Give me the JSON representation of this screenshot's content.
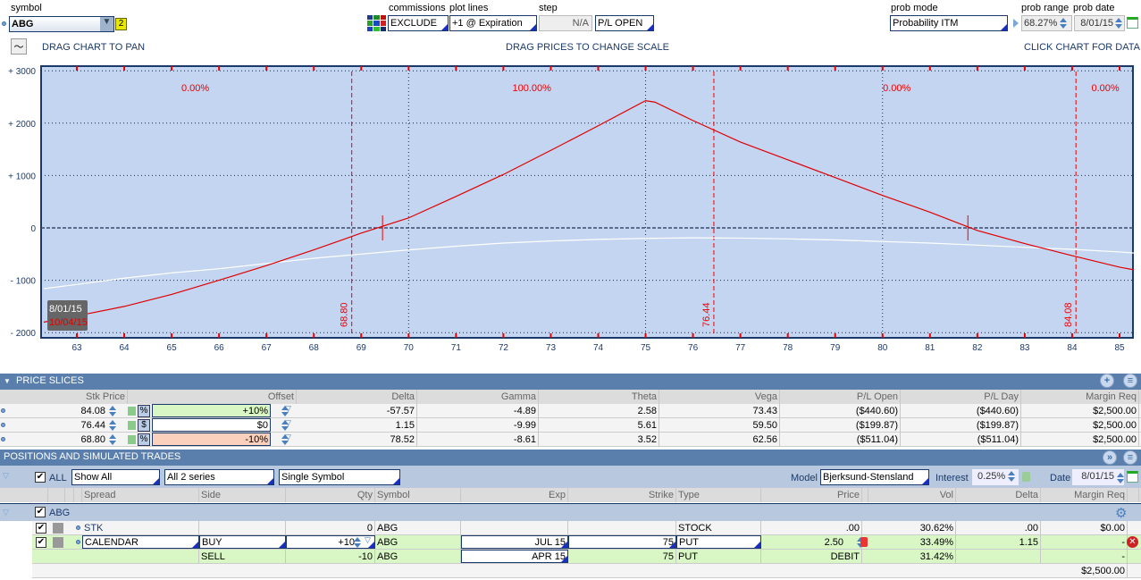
{
  "top": {
    "symbol_label": "symbol",
    "symbol_value": "ABG",
    "symbol_badge": "2",
    "commissions_label": "commissions",
    "commissions_value": "EXCLUDE",
    "plot_lines_label": "plot lines",
    "plot_lines_value": "+1 @ Expiration",
    "step_label": "step",
    "step_value": "N/A",
    "pl_value": "P/L OPEN",
    "prob_mode_label": "prob mode",
    "prob_mode_value": "Probability ITM",
    "prob_range_label": "prob range",
    "prob_range_value": "68.27%",
    "prob_date_label": "prob date",
    "prob_date_value": "8/01/15",
    "drag_pan": "DRAG CHART TO PAN",
    "drag_prices": "DRAG PRICES TO CHANGE SCALE",
    "click_chart": "CLICK CHART FOR DATA"
  },
  "chart_data": {
    "type": "line",
    "xlim": [
      62.3,
      85.3
    ],
    "ylim": [
      -2000,
      3000
    ],
    "x_ticks": [
      63,
      64,
      65,
      66,
      67,
      68,
      69,
      70,
      71,
      72,
      73,
      74,
      75,
      76,
      77,
      78,
      79,
      80,
      81,
      82,
      83,
      84,
      85
    ],
    "y_ticks": [
      {
        "v": 3000,
        "t": "+ 3000"
      },
      {
        "v": 2000,
        "t": "+ 2000"
      },
      {
        "v": 1000,
        "t": "+ 1000"
      },
      {
        "v": 0,
        "t": "0"
      },
      {
        "v": -1000,
        "t": "- 1000"
      },
      {
        "v": -2000,
        "t": "- 2000"
      }
    ],
    "grid_x": [
      70,
      75,
      80
    ],
    "slices": [
      {
        "v": 68.8,
        "t": "68.80"
      },
      {
        "v": 76.44,
        "t": "76.44"
      },
      {
        "v": 84.08,
        "t": "84.08"
      }
    ],
    "probs": [
      {
        "v": 65.5,
        "t": "0.00%"
      },
      {
        "v": 72.6,
        "t": "100.00%"
      },
      {
        "v": 80.3,
        "t": "0.00%"
      },
      {
        "v": 84.7,
        "t": "0.00%"
      }
    ],
    "breakevens": [
      69.45,
      81.8
    ],
    "series": [
      {
        "name": "10/04/15",
        "color": "#e00000",
        "points": [
          [
            62.3,
            -1800
          ],
          [
            63,
            -1680
          ],
          [
            64,
            -1500
          ],
          [
            65,
            -1270
          ],
          [
            66,
            -1000
          ],
          [
            67,
            -720
          ],
          [
            68,
            -420
          ],
          [
            69,
            -100
          ],
          [
            70,
            190
          ],
          [
            71,
            600
          ],
          [
            72,
            1020
          ],
          [
            73,
            1480
          ],
          [
            74,
            1950
          ],
          [
            75,
            2430
          ],
          [
            75.2,
            2400
          ],
          [
            76,
            2050
          ],
          [
            77,
            1640
          ],
          [
            78,
            1300
          ],
          [
            79,
            960
          ],
          [
            80,
            620
          ],
          [
            81,
            300
          ],
          [
            82,
            -50
          ],
          [
            83,
            -300
          ],
          [
            84,
            -530
          ],
          [
            85,
            -750
          ],
          [
            85.3,
            -800
          ]
        ]
      },
      {
        "name": "8/01/15",
        "color": "#ffffff",
        "points": [
          [
            62.3,
            -1160
          ],
          [
            63,
            -1080
          ],
          [
            64,
            -960
          ],
          [
            65,
            -860
          ],
          [
            66,
            -780
          ],
          [
            67,
            -680
          ],
          [
            68,
            -580
          ],
          [
            69,
            -500
          ],
          [
            70,
            -420
          ],
          [
            71,
            -350
          ],
          [
            72,
            -290
          ],
          [
            73,
            -250
          ],
          [
            74,
            -220
          ],
          [
            75,
            -200
          ],
          [
            76,
            -190
          ],
          [
            77,
            -195
          ],
          [
            78,
            -210
          ],
          [
            79,
            -230
          ],
          [
            80,
            -260
          ],
          [
            81,
            -290
          ],
          [
            82,
            -330
          ],
          [
            83,
            -370
          ],
          [
            84,
            -410
          ],
          [
            85,
            -460
          ],
          [
            85.3,
            -480
          ]
        ]
      }
    ]
  },
  "slices": {
    "title": "PRICE SLICES",
    "cols": [
      "Stk Price",
      "Offset",
      "Delta",
      "Gamma",
      "Theta",
      "Vega",
      "P/L Open",
      "P/L Day",
      "Margin Req"
    ],
    "rows": [
      {
        "price": "84.08",
        "unit": "%",
        "offset": "+10%",
        "delta": "-57.57",
        "gamma": "-4.89",
        "theta": "2.58",
        "vega": "73.43",
        "plopen": "($440.60)",
        "plday": "($440.60)",
        "margin": "$2,500.00"
      },
      {
        "price": "76.44",
        "unit": "$",
        "offset": "$0",
        "delta": "1.15",
        "gamma": "-9.99",
        "theta": "5.61",
        "vega": "59.50",
        "plopen": "($199.87)",
        "plday": "($199.87)",
        "margin": "$2,500.00"
      },
      {
        "price": "68.80",
        "unit": "%",
        "offset": "-10%",
        "delta": "78.52",
        "gamma": "-8.61",
        "theta": "3.52",
        "vega": "62.56",
        "plopen": "($511.04)",
        "plday": "($511.04)",
        "margin": "$2,500.00"
      }
    ]
  },
  "positions": {
    "title": "POSITIONS AND SIMULATED TRADES",
    "all": "ALL",
    "show": "Show All",
    "series": "All 2 series",
    "mode": "Single Symbol",
    "model_label": "Model",
    "model": "Bjerksund-Stensland",
    "interest_label": "Interest",
    "interest": "0.25%",
    "date_label": "Date",
    "date": "8/01/15",
    "cols": [
      "Spread",
      "Side",
      "Qty",
      "Symbol",
      "Exp",
      "Strike",
      "Type",
      "Price",
      "Vol",
      "Delta",
      "Margin Req"
    ],
    "group": "ABG",
    "rows": [
      {
        "spread": "STK",
        "side": "",
        "qty": "0",
        "symbol": "ABG",
        "exp": "",
        "strike": "",
        "type": "STOCK",
        "price": ".00",
        "vol": "30.62%",
        "delta": ".00",
        "margin": "$0.00"
      },
      {
        "spread": "CALENDAR",
        "side": "BUY",
        "qty": "+10",
        "symbol": "ABG",
        "exp": "JUL 15",
        "strike": "75",
        "type": "PUT",
        "price": "2.50",
        "vol": "33.49%",
        "delta": "1.15",
        "margin": "-"
      },
      {
        "spread": "",
        "side": "SELL",
        "qty": "-10",
        "symbol": "ABG",
        "exp": "APR 15",
        "strike": "75",
        "type": "PUT",
        "price": "DEBIT",
        "vol": "31.42%",
        "delta": "",
        "margin": "-"
      }
    ],
    "total_margin": "$2,500.00"
  }
}
